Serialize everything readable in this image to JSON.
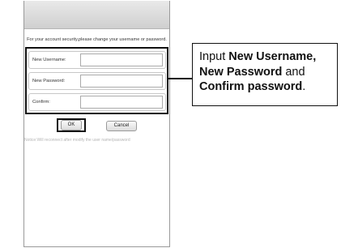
{
  "notice_top": "For your account security,please change your username or password.",
  "fields": [
    {
      "label": "New Username:",
      "value": ""
    },
    {
      "label": "New Password:",
      "value": ""
    },
    {
      "label": "Confirm:",
      "value": ""
    }
  ],
  "buttons": {
    "ok": "OK",
    "cancel": "Cancel"
  },
  "notice_bottom": "Notice:Will reconnect after modify the user name/password",
  "callout": {
    "p1": "Input ",
    "b1": "New Username,",
    "b2": "New Password",
    "p2": " and ",
    "b3": "Confirm password",
    "p3": "."
  }
}
